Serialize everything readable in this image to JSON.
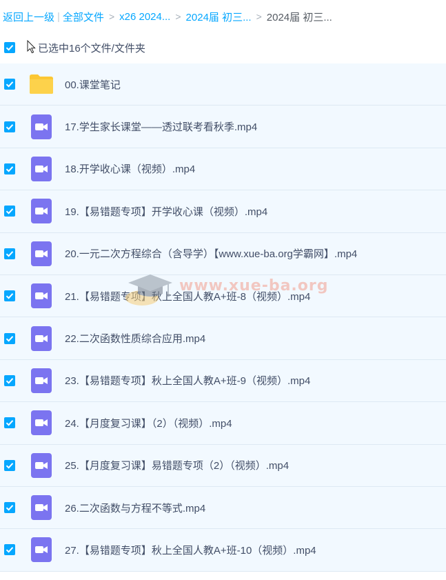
{
  "breadcrumb": {
    "back": "返回上一级",
    "separator": "|",
    "root": "全部文件",
    "crumbs": [
      "x26 2024...",
      "2024届 初三..."
    ],
    "current": "2024届 初三..."
  },
  "selection": {
    "label": "已选中16个文件/文件夹"
  },
  "files": [
    {
      "name": "00.课堂笔记",
      "icon": "folder-icon"
    },
    {
      "name": "17.学生家长课堂——透过联考看秋季.mp4",
      "icon": "video-file-icon"
    },
    {
      "name": "18.开学收心课（视频）.mp4",
      "icon": "video-file-icon"
    },
    {
      "name": "19.【易错题专项】开学收心课（视频）.mp4",
      "icon": "video-file-icon"
    },
    {
      "name": "20.一元二次方程综合（含导学）【www.xue-ba.org学霸网】.mp4",
      "icon": "video-file-icon"
    },
    {
      "name": "21.【易错题专项】秋上全国人教A+班-8（视频）.mp4",
      "icon": "video-file-icon"
    },
    {
      "name": "22.二次函数性质综合应用.mp4",
      "icon": "video-file-icon"
    },
    {
      "name": "23.【易错题专项】秋上全国人教A+班-9（视频）.mp4",
      "icon": "video-file-icon"
    },
    {
      "name": "24.【月度复习课】（2）（视频）.mp4",
      "icon": "video-file-icon"
    },
    {
      "name": "25.【月度复习课】易错题专项（2）（视频）.mp4",
      "icon": "video-file-icon"
    },
    {
      "name": "26.二次函数与方程不等式.mp4",
      "icon": "video-file-icon"
    },
    {
      "name": "27.【易错题专项】秋上全国人教A+班-10（视频）.mp4",
      "icon": "video-file-icon"
    }
  ],
  "watermark": {
    "text": "www.xue-ba.org"
  },
  "colors": {
    "accent": "#06a7ff",
    "row_background": "#f2f9ff",
    "folder": "#fcc733",
    "video_icon": "#7b74f0",
    "text": "#424e67"
  }
}
